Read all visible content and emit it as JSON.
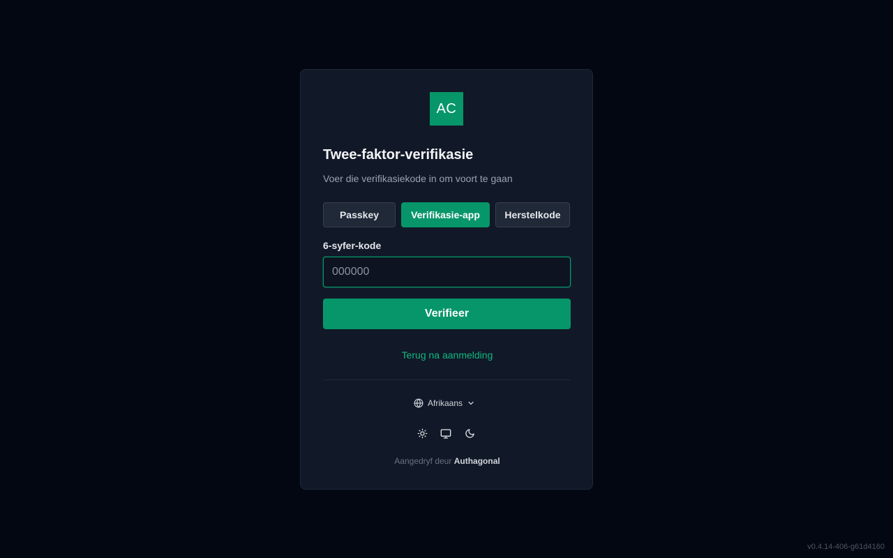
{
  "logo": {
    "text": "AC",
    "color": "#079669"
  },
  "heading": {
    "title": "Twee-faktor-verifikasie",
    "subtitle": "Voer die verifikasiekode in om voort te gaan"
  },
  "tabs": [
    {
      "label": "Passkey",
      "active": false
    },
    {
      "label": "Verifikasie-app",
      "active": true
    },
    {
      "label": "Herstelkode",
      "active": false
    }
  ],
  "code_field": {
    "label": "6-syfer-kode",
    "placeholder": "000000",
    "value": ""
  },
  "verify_button": {
    "label": "Verifieer"
  },
  "back_link": {
    "label": "Terug na aanmelding"
  },
  "language": {
    "selected": "Afrikaans",
    "icon": "globe-icon"
  },
  "theme_options": [
    {
      "name": "light",
      "icon": "sun-icon"
    },
    {
      "name": "system",
      "icon": "monitor-icon"
    },
    {
      "name": "dark",
      "icon": "moon-icon"
    }
  ],
  "footer": {
    "powered_prefix": "Aangedryf deur",
    "powered_brand": "Authagonal"
  },
  "version": "v0.4.14-406-g61d4160",
  "colors": {
    "accent": "#079669",
    "link": "#10b981",
    "background": "#030712",
    "card": "#111827"
  }
}
